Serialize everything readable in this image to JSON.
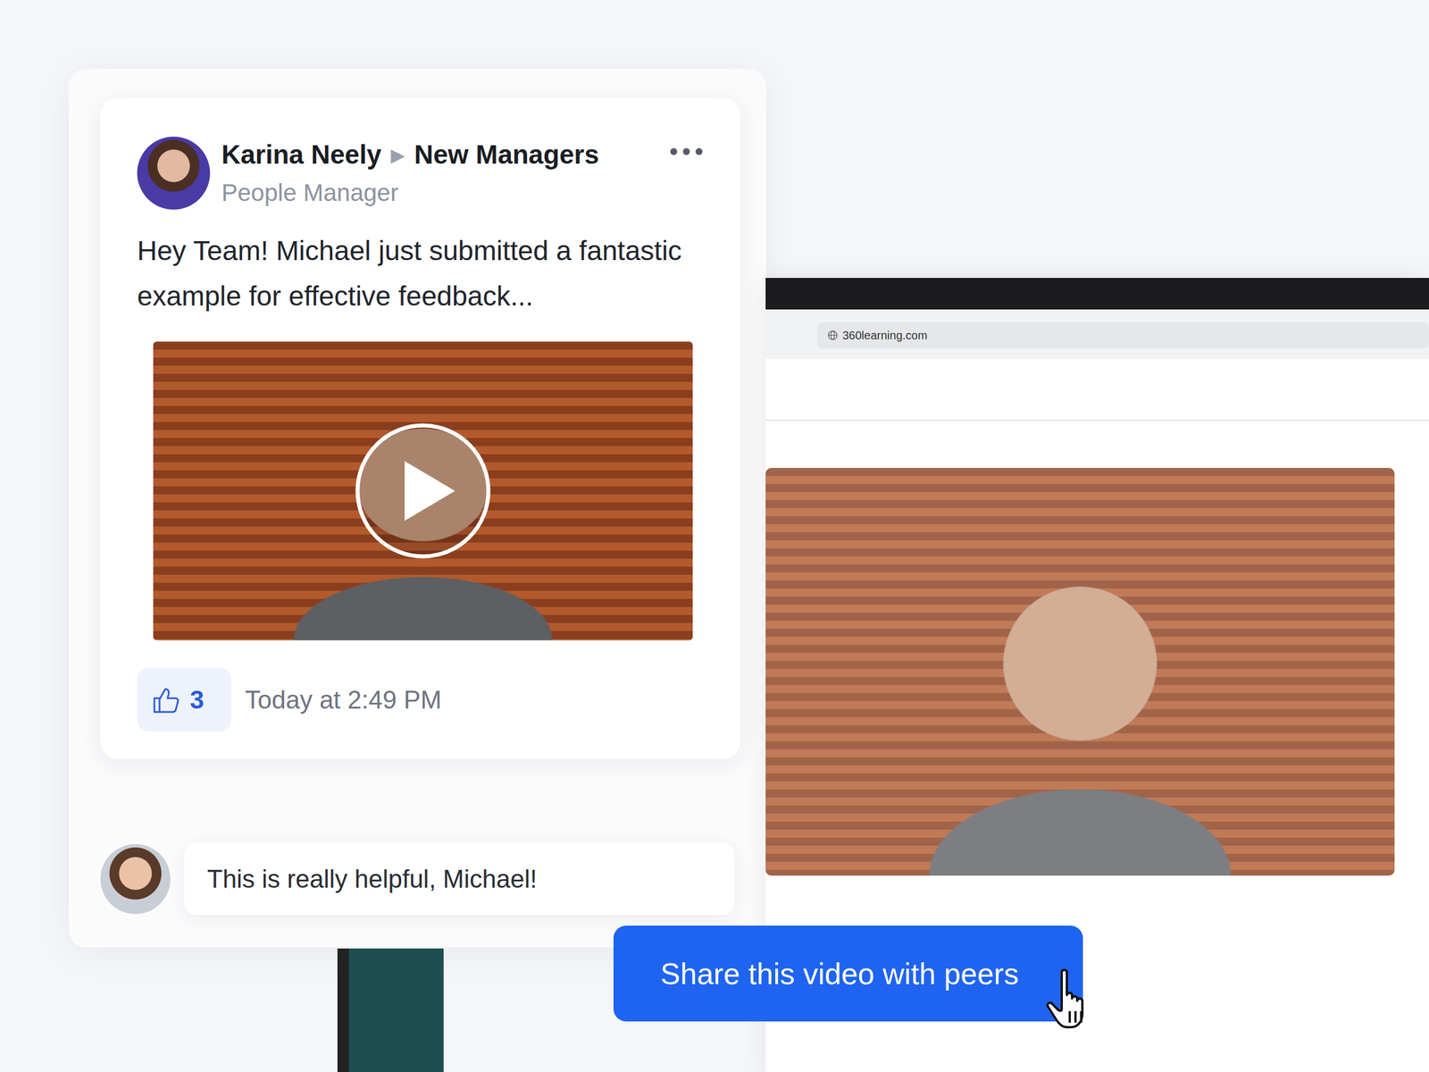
{
  "browser": {
    "url": "360learning.com"
  },
  "post": {
    "author": "Karina Neely",
    "arrow": "▶",
    "group": "New Managers",
    "role": "People Manager",
    "text": "Hey Team! Michael just submitted a fantastic example for effective feedback...",
    "likes": "3",
    "liked": true,
    "time": "Today at 2:49 PM"
  },
  "comment": {
    "text": "This is really helpful, Michael!"
  },
  "share_button": {
    "label": "Share this video with peers"
  }
}
